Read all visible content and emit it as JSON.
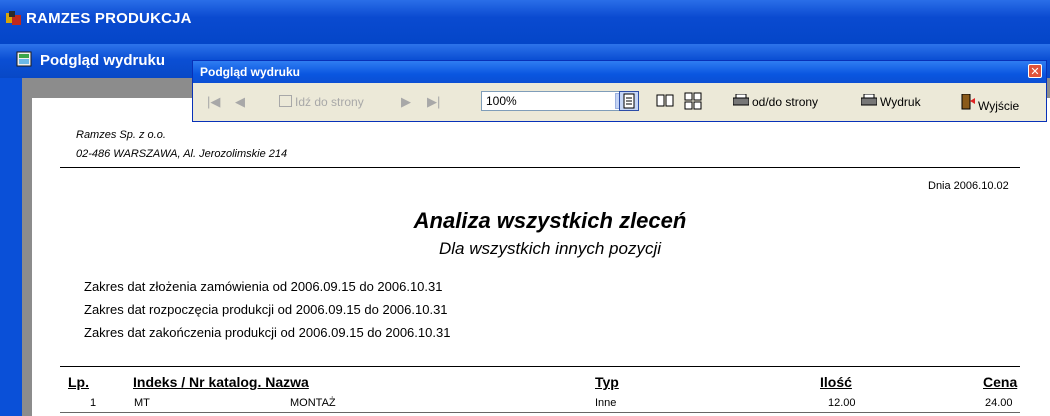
{
  "app": {
    "title": "RAMZES PRODUKCJA"
  },
  "mdi": {
    "title": "Podgląd wydruku"
  },
  "toolbar": {
    "title": "Podgląd wydruku",
    "close_glyph": "✕",
    "first_glyph": "|◀",
    "prev_glyph": "◀",
    "goto_label": "Idź do strony",
    "next_glyph": "▶",
    "last_glyph": "▶|",
    "zoom_value": "100%",
    "range_label": "od/do strony",
    "print_label": "Wydruk",
    "exit_label": "Wyjście"
  },
  "report": {
    "company_name": "Ramzes Sp. z o.o.",
    "company_address": "02-486 WARSZAWA, Al. Jerozolimskie 214",
    "date_label": "Dnia 2006.10.02",
    "title": "Analiza wszystkich zleceń",
    "subtitle": "Dla wszystkich innych pozycji",
    "ranges": [
      "Zakres dat złożenia zamówienia od 2006.09.15 do 2006.10.31",
      "Zakres dat rozpoczęcia produkcji od 2006.09.15 do 2006.10.31",
      "Zakres dat zakończenia produkcji od 2006.09.15 do 2006.10.31"
    ],
    "columns": {
      "lp": "Lp.",
      "indeks": "Indeks / Nr katalog. Nazwa",
      "typ": "Typ",
      "ilosc": "Ilość",
      "cena": "Cena"
    },
    "rows": [
      {
        "lp": "1",
        "indeks": "MT",
        "nazwa": "MONTAŻ",
        "typ": "Inne",
        "ilosc": "12.00",
        "cena": "24.00"
      }
    ]
  },
  "icons": {
    "app": "ramzes-app-icon",
    "mdi": "preview-window-icon",
    "goto": "goto-page-icon",
    "range": "printer-icon",
    "print": "printer-icon",
    "exit": "exit-door-icon"
  },
  "colors": {
    "titlebar": "#0a4ad0",
    "toolbar_bg": "#ece9d8",
    "close": "#e0533a",
    "frame": "#808080"
  }
}
